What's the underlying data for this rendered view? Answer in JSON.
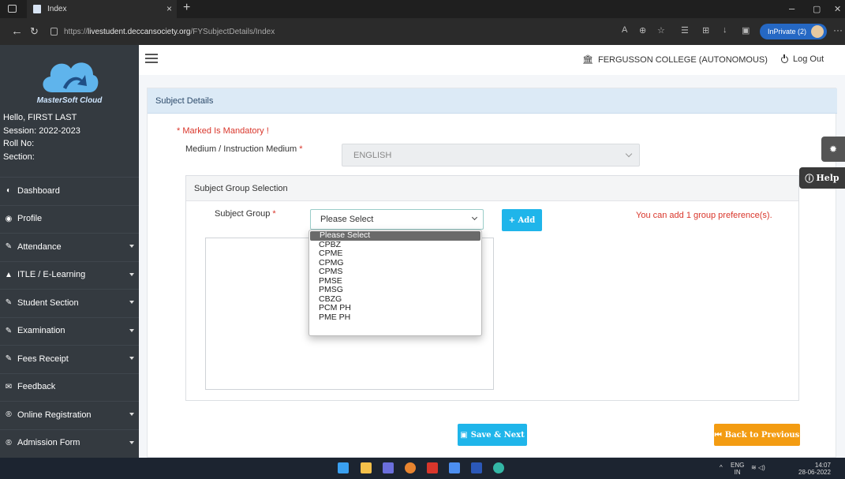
{
  "browser": {
    "tab_title": "Index",
    "tab_close": "×",
    "new_tab": "+",
    "url_prefix": "https://",
    "url_host": "livestudent.deccansociety.org",
    "url_path": "/FYSubjectDetails/Index",
    "inprivate_label": "InPrivate (2)",
    "minimize": "–",
    "maximize": "▢",
    "close": "✕"
  },
  "sidebar": {
    "logo_text": "MasterSoft Cloud",
    "user": {
      "greeting": "Hello, FIRST LAST",
      "session": "Session: 2022-2023",
      "roll": "Roll No:",
      "section": "Section:"
    },
    "items": [
      {
        "label": "Dashboard",
        "icon": "dashboard-icon",
        "glyph": "◐",
        "has_caret": false
      },
      {
        "label": "Profile",
        "icon": "profile-icon",
        "glyph": "◉",
        "has_caret": false
      },
      {
        "label": "Attendance",
        "icon": "pencil-icon",
        "glyph": "✎",
        "has_caret": true
      },
      {
        "label": "ITLE / E-Learning",
        "icon": "graduation-cap-icon",
        "glyph": "▲",
        "has_caret": true
      },
      {
        "label": "Student Section",
        "icon": "pencil-icon",
        "glyph": "✎",
        "has_caret": true
      },
      {
        "label": "Examination",
        "icon": "pencil-icon",
        "glyph": "✎",
        "has_caret": true
      },
      {
        "label": "Fees Receipt",
        "icon": "pencil-icon",
        "glyph": "✎",
        "has_caret": true
      },
      {
        "label": "Feedback",
        "icon": "comment-icon",
        "glyph": "✉",
        "has_caret": false
      },
      {
        "label": "Online Registration",
        "icon": "registered-icon",
        "glyph": "®",
        "has_caret": true
      },
      {
        "label": "Admission Form",
        "icon": "registered-icon",
        "glyph": "®",
        "has_caret": true
      }
    ]
  },
  "topnav": {
    "college": "FERGUSSON COLLEGE (AUTONOMOUS)",
    "logout": "Log Out"
  },
  "card": {
    "title": "Subject Details",
    "mandatory_note": "* Marked Is Mandatory !",
    "medium_label": "Medium / Instruction Medium",
    "medium_value": "ENGLISH",
    "group_section_title": "Subject Group Selection",
    "subject_group_label": "Subject Group",
    "subject_group_value": "Please Select",
    "add_button": "+ Add",
    "preference_note": "You can add 1 group preference(s).",
    "save_button": "Save & Next",
    "back_button": "Back to Previous"
  },
  "dropdown_options": [
    "Please Select",
    "CPBZ",
    "CPME",
    "CPMG",
    "CPMS",
    "PMSE",
    "PMSG",
    "CBZG",
    "PCM PH",
    "PME PH"
  ],
  "widgets": {
    "help_label": "Help"
  },
  "taskbar": {
    "lang_top": "ENG",
    "lang_bottom": "IN",
    "time": "14:07",
    "date": "28-06-2022"
  },
  "colors": {
    "sidebar_bg": "#343a40",
    "card_header_bg": "#dceaf6",
    "primary_button": "#1fb5ea",
    "warning_button": "#f39c12",
    "mandatory_red": "#d9362b"
  }
}
